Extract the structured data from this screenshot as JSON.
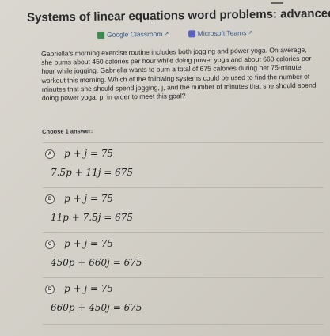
{
  "title": "Systems of linear equations word problems: advanced",
  "share": {
    "classroom_label": "Google Classroom",
    "teams_label": "Microsoft Teams"
  },
  "question": "Gabriella's morning exercise routine includes both jogging and power yoga. On average, she burns about 450 calories per hour while doing power yoga and about 660 calories per hour while jogging. Gabriella wants to burn a total of 675 calories during her 75-minute workout this morning. Which of the following systems could be used to find the number of minutes that she should spend jogging, j, and the number of minutes that she should spend doing power yoga, p, in order to meet this goal?",
  "choose_label": "Choose 1 answer:",
  "options": [
    {
      "letter": "A",
      "eq1": "p + j = 75",
      "eq2": "7.5p + 11j = 675"
    },
    {
      "letter": "B",
      "eq1": "p + j = 75",
      "eq2": "11p + 7.5j = 675"
    },
    {
      "letter": "C",
      "eq1": "p + j = 75",
      "eq2": "450p + 660j = 675"
    },
    {
      "letter": "D",
      "eq1": "p + j = 75",
      "eq2": "660p + 450j = 675"
    }
  ]
}
